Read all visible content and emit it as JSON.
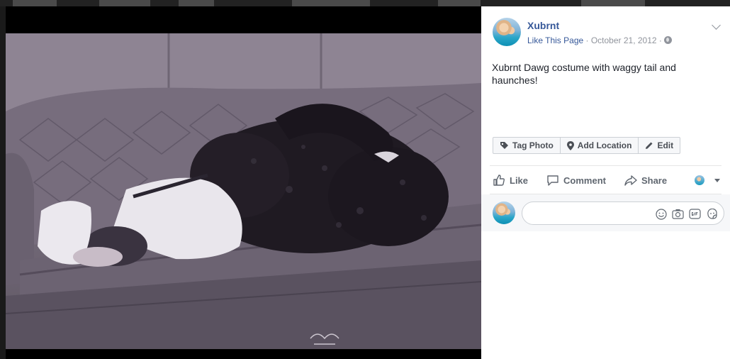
{
  "post": {
    "page_name": "Xubrnt",
    "like_page": "Like This Page",
    "separator": " · ",
    "date": "October 21, 2012",
    "text": "Xubrnt Dawg costume with waggy tail and haunches!",
    "privacy_icon": "globe-icon"
  },
  "photo_actions": {
    "tag": "Tag Photo",
    "location": "Add Location",
    "edit": "Edit"
  },
  "ufi": {
    "like": "Like",
    "comment": "Comment",
    "share": "Share"
  },
  "comment_box": {
    "placeholder": "",
    "icons": [
      "smiley-icon",
      "camera-icon",
      "gif-icon",
      "sticker-icon"
    ]
  },
  "colors": {
    "link": "#365899",
    "meta": "#90949c",
    "text": "#1d2129",
    "action_text": "#606770"
  }
}
